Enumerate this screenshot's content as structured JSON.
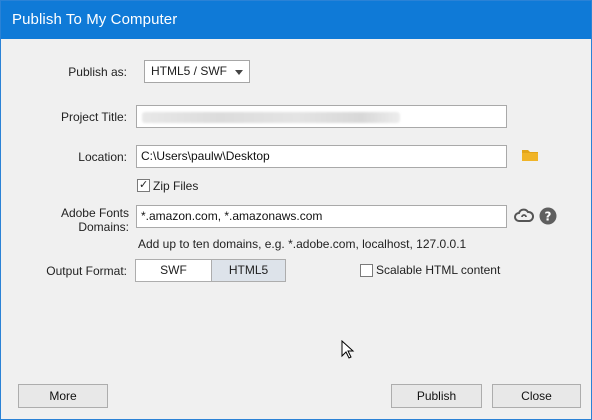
{
  "window": {
    "title": "Publish To My Computer"
  },
  "publish_as": {
    "label": "Publish as:",
    "value": "HTML5 / SWF"
  },
  "project_title": {
    "label": "Project Title:",
    "value": ""
  },
  "location": {
    "label": "Location:",
    "value": "C:\\Users\\paulw\\Desktop"
  },
  "zip_files": {
    "label": "Zip Files",
    "checked": true
  },
  "fonts_domains": {
    "label": "Adobe Fonts Domains:",
    "value": "*.amazon.com, *.amazonaws.com",
    "hint": "Add up to ten domains, e.g. *.adobe.com, localhost, 127.0.0.1"
  },
  "output_format": {
    "label": "Output Format:",
    "options": [
      "SWF",
      "HTML5"
    ],
    "selected": "HTML5"
  },
  "scalable": {
    "label": "Scalable HTML content",
    "checked": false
  },
  "buttons": {
    "more": "More",
    "publish": "Publish",
    "close": "Close"
  },
  "colors": {
    "titlebar": "#0f7ad7",
    "folder_icon": "#e2a51a",
    "selected_segment": "#dde3ea"
  },
  "icons": {
    "folder": "folder-icon",
    "cloud": "creative-cloud-icon",
    "help": "help-icon",
    "cursor": "mouse-cursor-icon"
  }
}
